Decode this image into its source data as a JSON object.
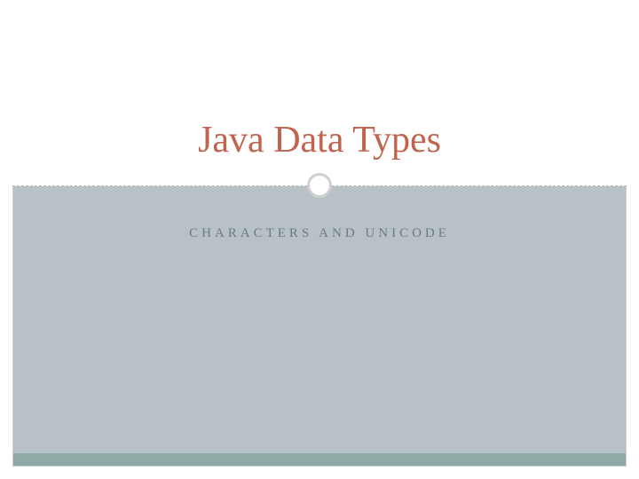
{
  "slide": {
    "title": "Java Data Types",
    "subtitle": "CHARACTERS AND UNICODE"
  }
}
